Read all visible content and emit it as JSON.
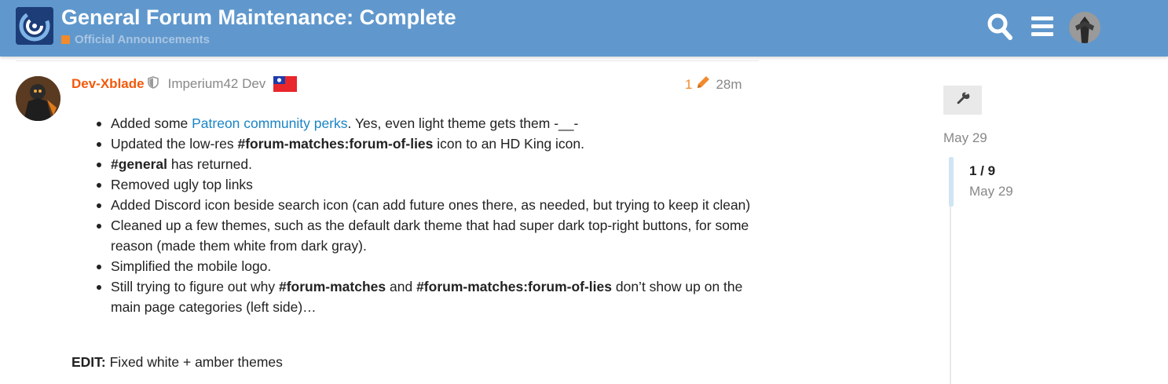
{
  "header": {
    "title": "General Forum Maintenance: Complete",
    "category": "Official Announcements",
    "category_color": "#f28a2e",
    "bg_color": "#6098cd",
    "icons": [
      "logo",
      "search-icon",
      "hamburger-menu-icon",
      "user-avatar"
    ]
  },
  "post": {
    "username": "Dev-Xblade",
    "user_title": "Imperium42 Dev",
    "edit_count": "1",
    "age": "28m",
    "items": [
      [
        {
          "t": "Added some "
        },
        {
          "t": "Patreon community perks",
          "s": "link"
        },
        {
          "t": ". Yes, even light theme gets them -__-"
        }
      ],
      [
        {
          "t": "Updated the low-res "
        },
        {
          "t": "#forum-matches:forum-of-lies",
          "s": "b"
        },
        {
          "t": " icon to an HD King icon."
        }
      ],
      [
        {
          "t": "#general",
          "s": "b"
        },
        {
          "t": " has returned."
        }
      ],
      [
        {
          "t": "Removed ugly top links"
        }
      ],
      [
        {
          "t": "Added Discord icon beside search icon (can add future ones there, as needed, but trying to keep it clean)"
        }
      ],
      [
        {
          "t": "Cleaned up a few themes, such as the default dark theme that had super dark top-right buttons, for some reason (made them white from dark gray)."
        }
      ],
      [
        {
          "t": "Simplified the mobile logo."
        }
      ],
      [
        {
          "t": "Still trying to figure out why "
        },
        {
          "t": "#forum-matches",
          "s": "b"
        },
        {
          "t": " and "
        },
        {
          "t": "#forum-matches:forum-of-lies",
          "s": "b"
        },
        {
          "t": " don’t show up on the main page categories (left side)…"
        }
      ]
    ],
    "edit_label": "EDIT:",
    "edit_text": " Fixed white + amber themes"
  },
  "timeline": {
    "date_top": "May 29",
    "count": "1 / 9",
    "date_bottom": "May 29"
  }
}
